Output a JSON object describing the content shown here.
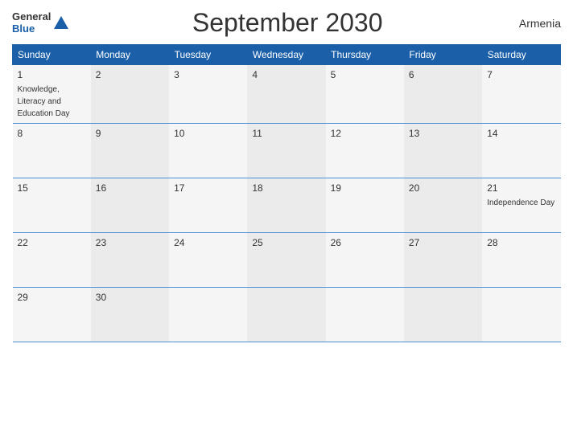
{
  "header": {
    "logo_line1": "General",
    "logo_line2": "Blue",
    "title": "September 2030",
    "country": "Armenia"
  },
  "days_of_week": [
    "Sunday",
    "Monday",
    "Tuesday",
    "Wednesday",
    "Thursday",
    "Friday",
    "Saturday"
  ],
  "weeks": [
    [
      {
        "day": "1",
        "event": "Knowledge,\nLiteracy and\nEducation Day"
      },
      {
        "day": "2",
        "event": ""
      },
      {
        "day": "3",
        "event": ""
      },
      {
        "day": "4",
        "event": ""
      },
      {
        "day": "5",
        "event": ""
      },
      {
        "day": "6",
        "event": ""
      },
      {
        "day": "7",
        "event": ""
      }
    ],
    [
      {
        "day": "8",
        "event": ""
      },
      {
        "day": "9",
        "event": ""
      },
      {
        "day": "10",
        "event": ""
      },
      {
        "day": "11",
        "event": ""
      },
      {
        "day": "12",
        "event": ""
      },
      {
        "day": "13",
        "event": ""
      },
      {
        "day": "14",
        "event": ""
      }
    ],
    [
      {
        "day": "15",
        "event": ""
      },
      {
        "day": "16",
        "event": ""
      },
      {
        "day": "17",
        "event": ""
      },
      {
        "day": "18",
        "event": ""
      },
      {
        "day": "19",
        "event": ""
      },
      {
        "day": "20",
        "event": ""
      },
      {
        "day": "21",
        "event": "Independence Day"
      }
    ],
    [
      {
        "day": "22",
        "event": ""
      },
      {
        "day": "23",
        "event": ""
      },
      {
        "day": "24",
        "event": ""
      },
      {
        "day": "25",
        "event": ""
      },
      {
        "day": "26",
        "event": ""
      },
      {
        "day": "27",
        "event": ""
      },
      {
        "day": "28",
        "event": ""
      }
    ],
    [
      {
        "day": "29",
        "event": ""
      },
      {
        "day": "30",
        "event": ""
      },
      {
        "day": "",
        "event": ""
      },
      {
        "day": "",
        "event": ""
      },
      {
        "day": "",
        "event": ""
      },
      {
        "day": "",
        "event": ""
      },
      {
        "day": "",
        "event": ""
      }
    ]
  ],
  "colors": {
    "header_bg": "#1a5fa8",
    "row_odd": "#f5f5f5",
    "row_even": "#ebebeb"
  }
}
